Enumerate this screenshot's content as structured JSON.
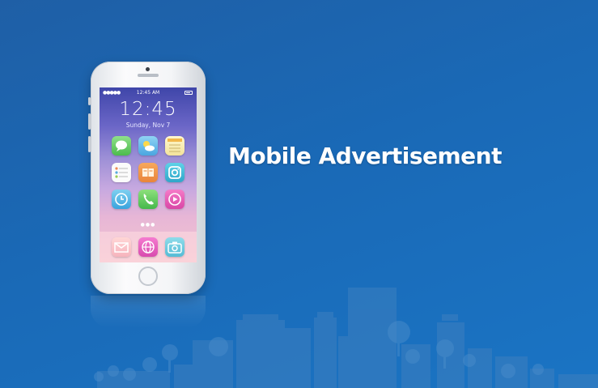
{
  "headline": "Mobile Advertisement",
  "phone": {
    "status_time": "12:45 AM",
    "signal": "●●●●●",
    "clock_time": "12:45",
    "date": "Sunday, Nov 7",
    "page_indicator": "●●●",
    "home_apps": [
      "messages-icon",
      "weather-icon",
      "notes-icon",
      "reminders-icon",
      "books-icon",
      "camera-app-icon",
      "clock-icon",
      "phone-icon",
      "video-icon"
    ],
    "dock_apps": [
      "mail-icon",
      "browser-icon",
      "camera-icon"
    ]
  },
  "colors": {
    "background": "#1a69b6",
    "headline": "#ffffff",
    "phone_body": "#f4f5f7"
  }
}
